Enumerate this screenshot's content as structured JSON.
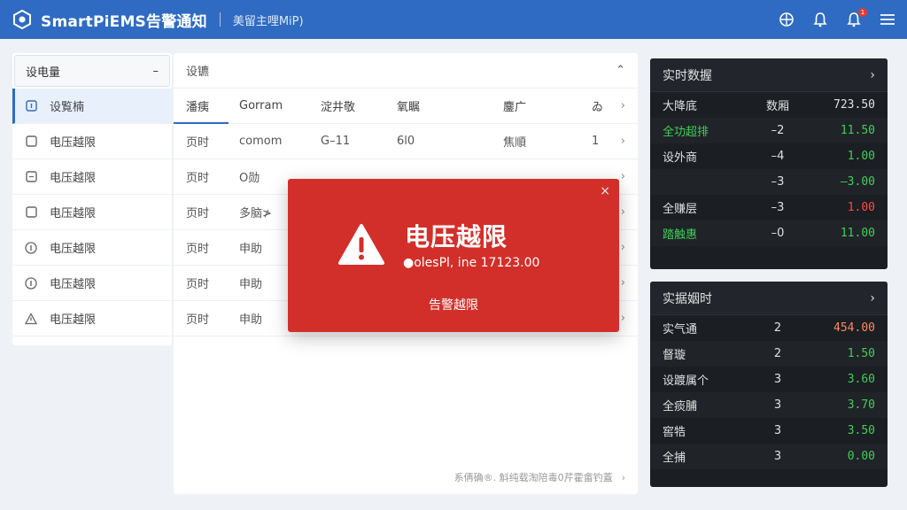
{
  "header": {
    "title": "SmartPiEMS告警通知",
    "subtitle": "美留主哩MiP)",
    "notification_count": "1"
  },
  "left_panel": {
    "select_label": "设电量",
    "select_arrow": "–",
    "items": [
      {
        "label": "设覧楠",
        "icon": "square-icon",
        "active": true
      },
      {
        "label": "电压越限",
        "icon": "square-icon"
      },
      {
        "label": "电压越限",
        "icon": "square-icon"
      },
      {
        "label": "电压越限",
        "icon": "square-icon"
      },
      {
        "label": "电压越限",
        "icon": "info-circle-icon"
      },
      {
        "label": "电压越限",
        "icon": "info-circle-icon"
      },
      {
        "label": "电压越限",
        "icon": "warning-triangle-icon"
      }
    ]
  },
  "center_panel": {
    "title": "设镳",
    "columns": [
      "潘痍",
      "Gorram",
      "淀井敬",
      "氧瞩",
      "鏖广",
      "ゐ"
    ],
    "rows": [
      [
        "页时",
        "comom",
        "G–11",
        "6l0",
        "焦順",
        "1"
      ],
      [
        "页时",
        "O勋",
        "",
        "",
        "",
        ""
      ],
      [
        "页时",
        "多脑≯",
        "",
        "",
        "",
        ""
      ],
      [
        "页时",
        "申助",
        "",
        "",
        "",
        ""
      ],
      [
        "页时",
        "申助",
        "",
        "",
        "",
        ""
      ],
      [
        "页时",
        "申助",
        "",
        "",
        "",
        ""
      ]
    ],
    "footer_text": "系侢确®. 斛纯载淘陪毒0芹霍畲钓蓋"
  },
  "realtime_panel": {
    "title": "实时数握",
    "rows": [
      {
        "name": "大降底",
        "num": "数厢",
        "value": "723.50",
        "name_color": "#e0e0e0",
        "value_color": "#e0e0e0"
      },
      {
        "name": "全功超排",
        "num": "–2",
        "value": "11.50",
        "name_color": "#3fcf5a",
        "value_color": "#3fcf5a"
      },
      {
        "name": "设外商",
        "num": "–4",
        "value": "1.00",
        "name_color": "#e0e0e0",
        "value_color": "#3fcf5a"
      },
      {
        "name": "",
        "num": "–3",
        "value": "–3.00",
        "name_color": "#e0e0e0",
        "value_color": "#3fcf5a"
      },
      {
        "name": "全赚层",
        "num": "–3",
        "value": "1.00",
        "name_color": "#e0e0e0",
        "value_color": "#ff4b3a"
      },
      {
        "name": "踏触惠",
        "num": "–0",
        "value": "11.00",
        "name_color": "#3fcf5a",
        "value_color": "#3fcf5a"
      }
    ]
  },
  "timing_panel": {
    "title": "实据姻时",
    "rows": [
      {
        "name": "实气通",
        "num": "2",
        "value": "454.00",
        "value_color": "#ff8a5c"
      },
      {
        "name": "督璇",
        "num": "2",
        "value": "1.50",
        "value_color": "#3fcf5a"
      },
      {
        "name": "设踱属个",
        "num": "3",
        "value": "3.60",
        "value_color": "#3fcf5a"
      },
      {
        "name": "全痰脯",
        "num": "3",
        "value": "3.70",
        "value_color": "#3fcf5a"
      },
      {
        "name": "窖牿",
        "num": "3",
        "value": "3.50",
        "value_color": "#3fcf5a"
      },
      {
        "name": "全捕",
        "num": "3",
        "value": "0.00",
        "value_color": "#3fcf5a"
      }
    ]
  },
  "alert": {
    "title": "电压越限",
    "detail": "●olesPl, ine 17123.00",
    "action": "告警越限",
    "close": "×"
  },
  "colors": {
    "header_bg": "#2f6bc2",
    "alert_bg": "#d32f2a",
    "dark_panel_bg": "#1b1e23",
    "positive": "#3fcf5a",
    "negative": "#ff4b3a"
  }
}
